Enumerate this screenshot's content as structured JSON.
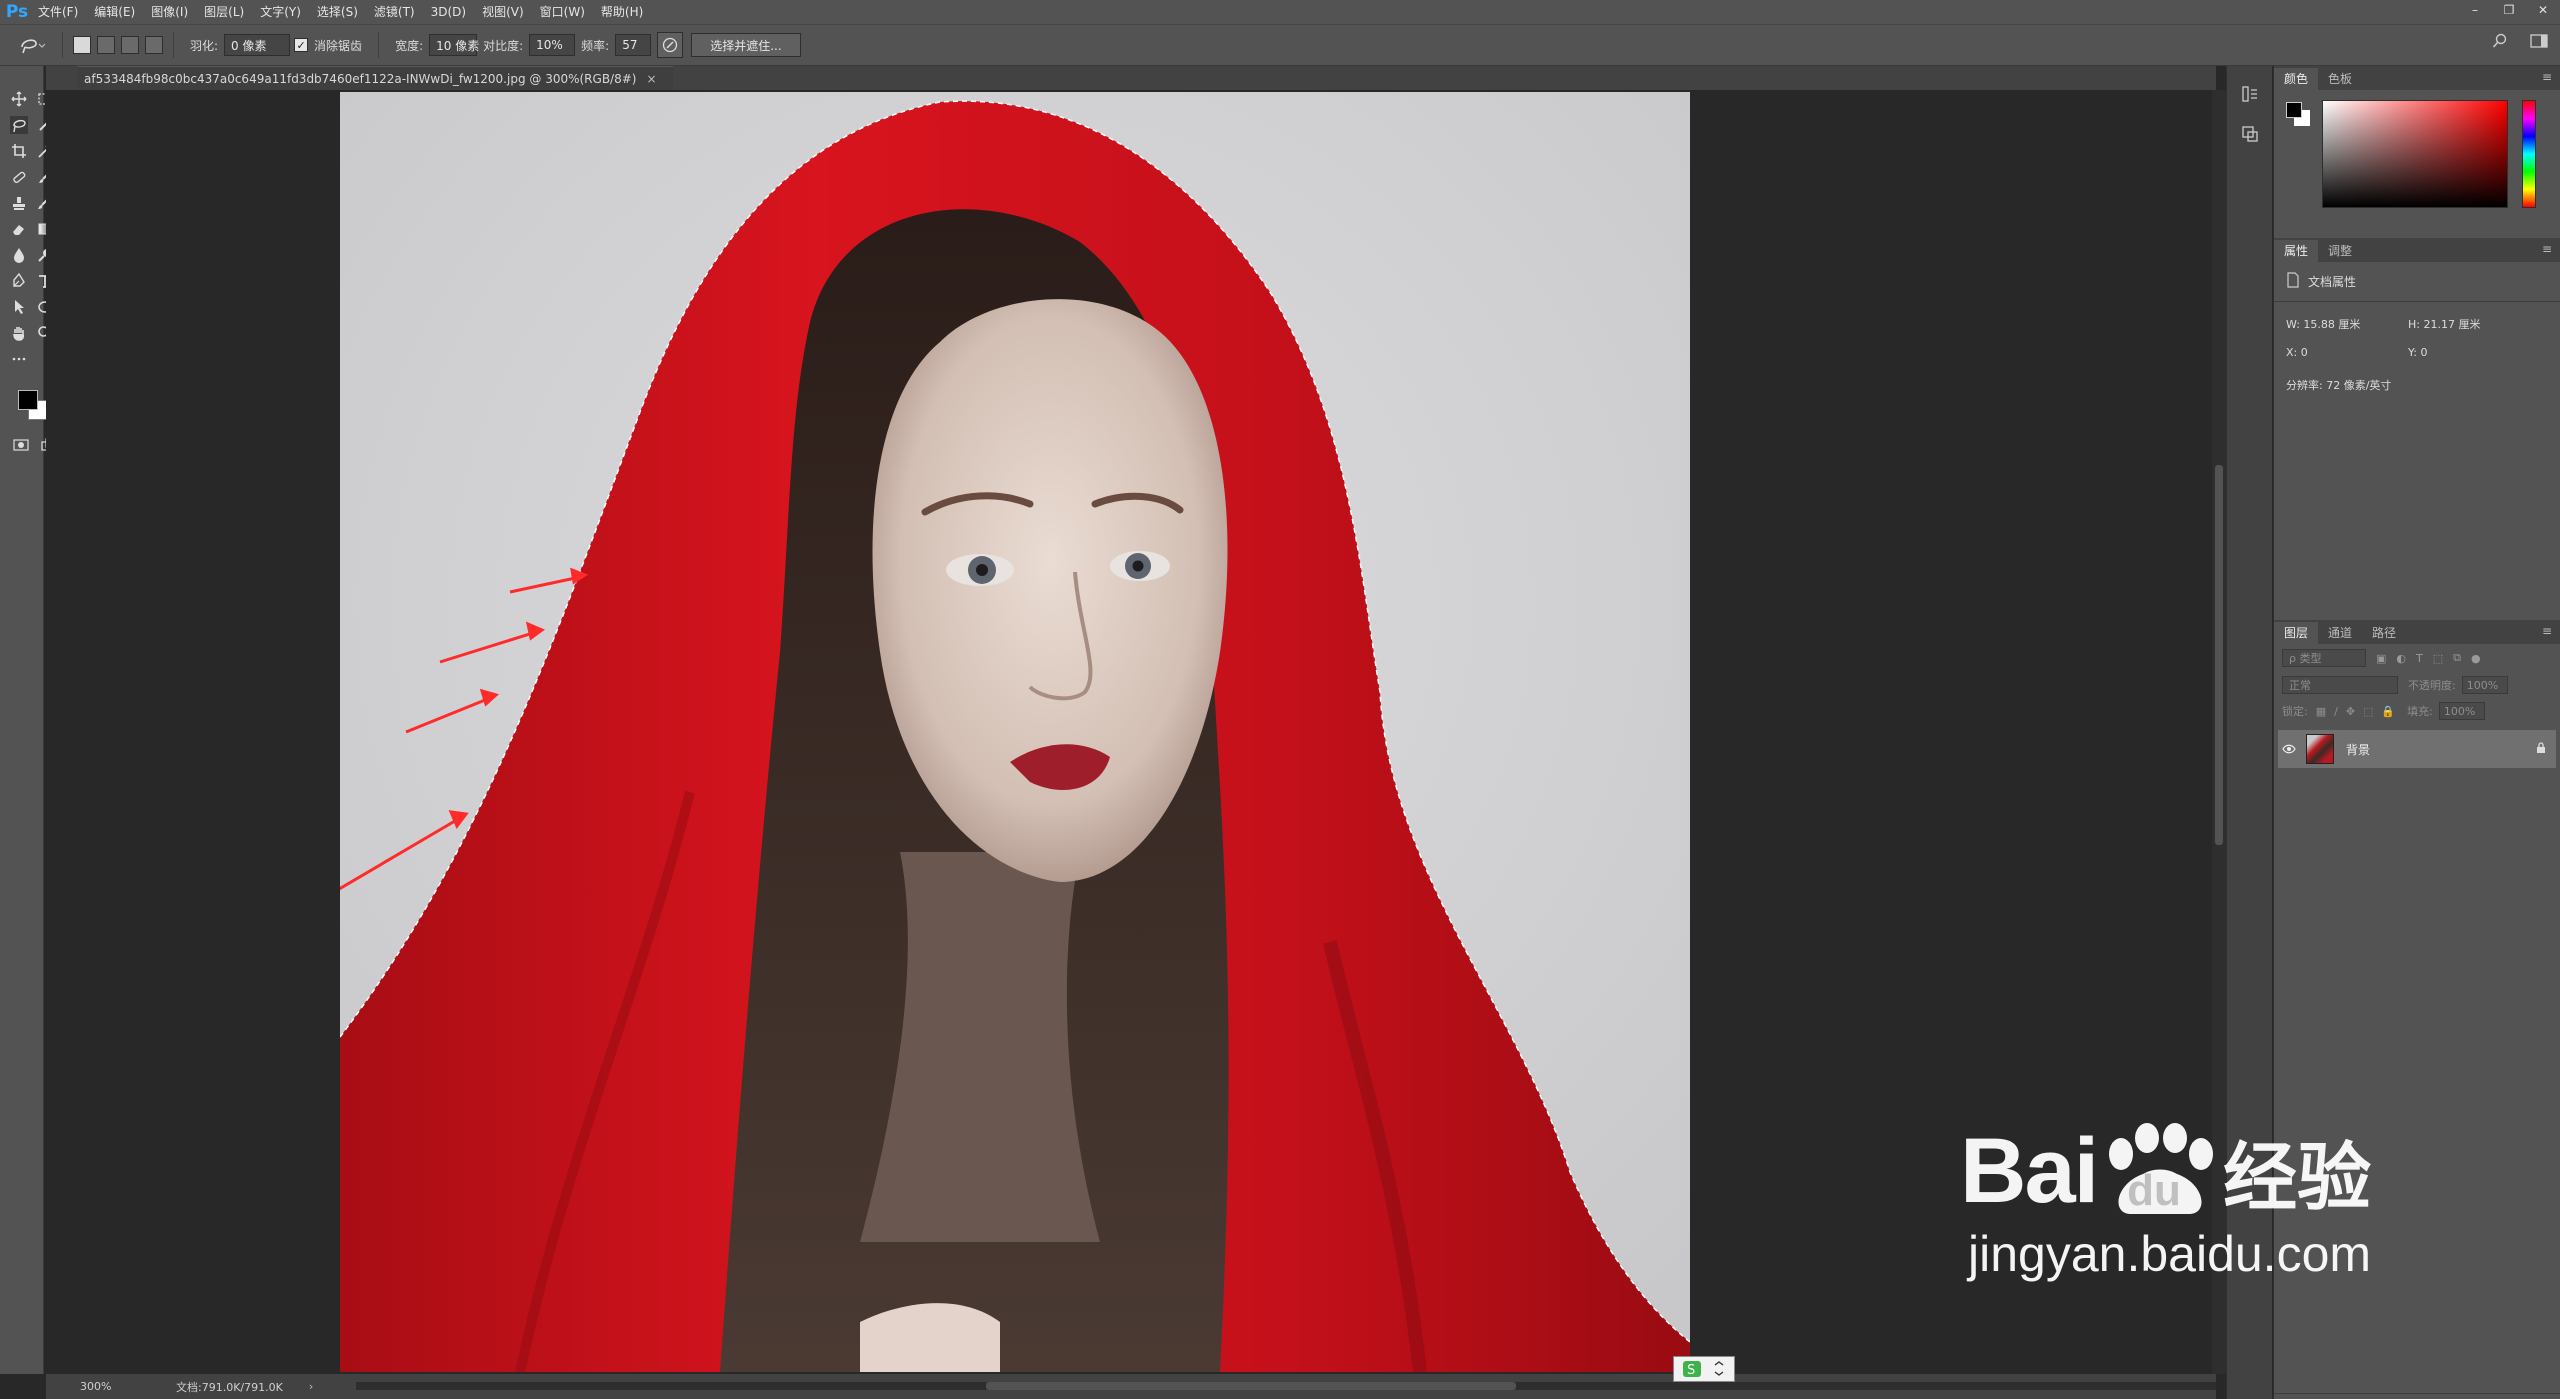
{
  "app": {
    "logo": "Ps"
  },
  "menu": [
    "文件(F)",
    "编辑(E)",
    "图像(I)",
    "图层(L)",
    "文字(Y)",
    "选择(S)",
    "滤镜(T)",
    "3D(D)",
    "视图(V)",
    "窗口(W)",
    "帮助(H)"
  ],
  "window_controls": [
    "–",
    "❐",
    "✕"
  ],
  "options": {
    "feather_label": "羽化:",
    "feather_value": "0 像素",
    "antialias_label": "消除锯齿",
    "antialias_checked": true,
    "width_label": "宽度:",
    "width_value": "10 像素",
    "contrast_label": "对比度:",
    "contrast_value": "10%",
    "frequency_label": "频率:",
    "frequency_value": "57",
    "select_mask_button": "选择并遮住..."
  },
  "document": {
    "tab_title": "af533484fb98c0bc437a0c649a11fd3db7460ef1122a-INWwDi_fw1200.jpg @ 300%(RGB/8#)",
    "close": "×"
  },
  "status": {
    "zoom": "300%",
    "doc_size": "文档:791.0K/791.0K",
    "arrow": "›"
  },
  "panels": {
    "color_tabs": [
      "颜色",
      "色板"
    ],
    "props_tabs": [
      "属性",
      "调整"
    ],
    "props_title": "文档属性",
    "props_w": "W:  15.88 厘米",
    "props_h": "H:  21.17 厘米",
    "props_x": "X:  0",
    "props_y": "Y:  0",
    "props_resolution": "分辨率: 72 像素/英寸",
    "layers_tabs": [
      "图层",
      "通道",
      "路径"
    ],
    "layers_filter": "ρ 类型",
    "blend_mode": "正常",
    "opacity_label": "不透明度:",
    "opacity_value": "100%",
    "lock_label": "锁定:",
    "fill_label": "填充:",
    "fill_value": "100%",
    "layer_name": "背景",
    "panel_menu": "≡"
  },
  "watermark": {
    "line1_a": "Bai",
    "line1_b": "du",
    "line1_c": "经验",
    "line2": "jingyan.baidu.com"
  },
  "colors": {
    "accent": "#31a8ff",
    "hood_red": "#c8121c",
    "annotation_arrow": "#ff2a2a",
    "background_gray": "#cfcfd1"
  }
}
